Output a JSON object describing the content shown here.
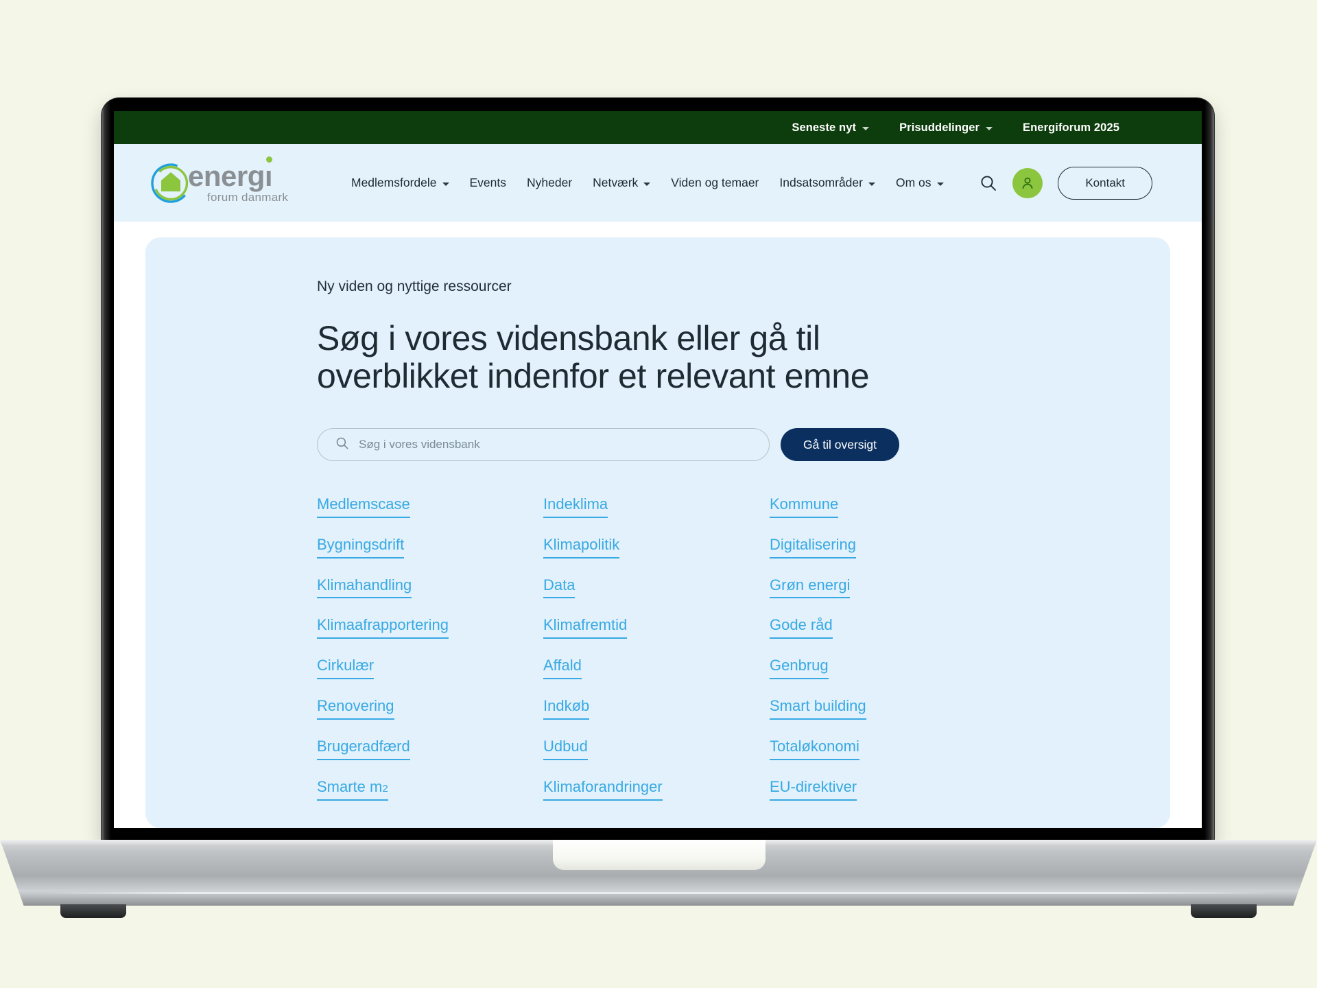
{
  "topbar": {
    "links": [
      {
        "label": "Seneste nyt",
        "has_dropdown": true
      },
      {
        "label": "Prisuddelinger",
        "has_dropdown": true
      },
      {
        "label": "Energiforum 2025",
        "has_dropdown": false
      }
    ]
  },
  "header": {
    "logo": {
      "word": "energi",
      "sub": "forum danmark"
    },
    "nav": [
      {
        "label": "Medlemsfordele",
        "has_dropdown": true
      },
      {
        "label": "Events",
        "has_dropdown": false
      },
      {
        "label": "Nyheder",
        "has_dropdown": false
      },
      {
        "label": "Netværk",
        "has_dropdown": true
      },
      {
        "label": "Viden og temaer",
        "has_dropdown": false
      },
      {
        "label": "Indsatsområder",
        "has_dropdown": true
      },
      {
        "label": "Om os",
        "has_dropdown": true
      }
    ],
    "search_icon": "search-icon",
    "avatar_icon": "user-icon",
    "contact_label": "Kontakt"
  },
  "hero": {
    "eyebrow": "Ny viden og nyttige ressourcer",
    "title": "Søg i vores vidensbank eller gå til overblikket indenfor et relevant emne",
    "search_placeholder": "Søg i vores vidensbank",
    "search_value": "",
    "overview_button": "Gå til oversigt"
  },
  "topics": {
    "column1": [
      "Medlemscase",
      "Bygningsdrift",
      "Klimahandling",
      "Klimaafrapportering",
      "Cirkulær",
      "Renovering",
      "Brugeradfærd",
      "Smarte m2"
    ],
    "column2": [
      "Indeklima",
      "Klimapolitik",
      "Data",
      "Klimafremtid",
      "Affald",
      "Indkøb",
      "Udbud",
      "Klimaforandringer"
    ],
    "column3": [
      "Kommune",
      "Digitalisering",
      "Grøn energi",
      "Gode råd",
      "Genbrug",
      "Smart building",
      "Totaløkonomi",
      "EU-direktiver"
    ]
  },
  "colors": {
    "page_background": "#f4f7e8",
    "topbar_green": "#0d3d0d",
    "header_blue": "#e4f2fb",
    "hero_card_blue": "#e2f1fb",
    "link_blue": "#38a9e4",
    "button_navy": "#0b2f5e",
    "avatar_green": "#8cc63f"
  }
}
